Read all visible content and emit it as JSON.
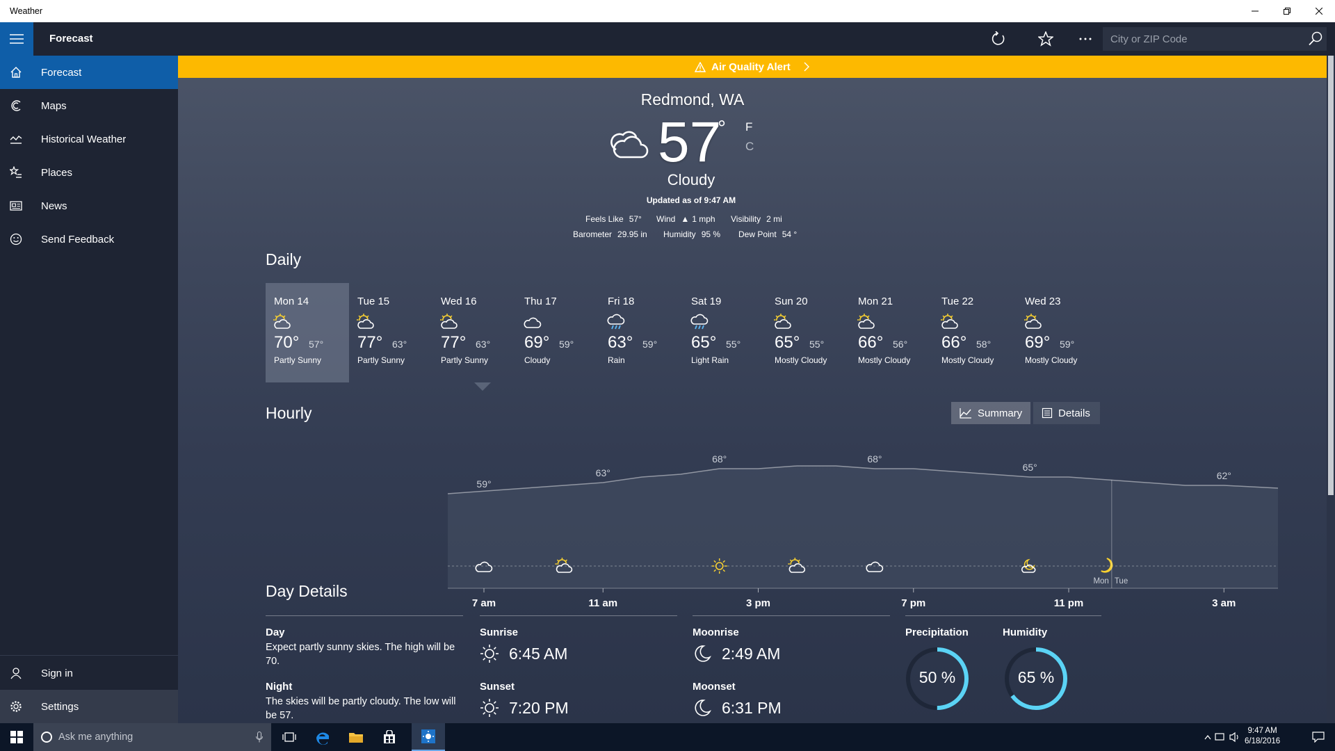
{
  "window": {
    "title": "Weather"
  },
  "appbar": {
    "title": "Forecast",
    "search_placeholder": "City or ZIP Code"
  },
  "sidebar": {
    "items": [
      {
        "label": "Forecast",
        "icon": "home-icon"
      },
      {
        "label": "Maps",
        "icon": "maps-icon"
      },
      {
        "label": "Historical Weather",
        "icon": "historical-icon"
      },
      {
        "label": "Places",
        "icon": "places-icon"
      },
      {
        "label": "News",
        "icon": "news-icon"
      },
      {
        "label": "Send Feedback",
        "icon": "feedback-icon"
      }
    ],
    "bottom": [
      {
        "label": "Sign in",
        "icon": "person-icon"
      },
      {
        "label": "Settings",
        "icon": "gear-icon"
      }
    ]
  },
  "alert": {
    "label": "Air Quality Alert",
    "color": "#fdb900"
  },
  "current": {
    "city": "Redmond, WA",
    "temp": "57",
    "deg": "°",
    "unit_f": "F",
    "unit_c": "C",
    "condition": "Cloudy",
    "updated": "Updated as of 9:47 AM",
    "stats": {
      "feels_like_label": "Feels Like",
      "feels_like": "57°",
      "wind_label": "Wind",
      "wind": "1 mph",
      "visibility_label": "Visibility",
      "visibility": "2 mi",
      "barometer_label": "Barometer",
      "barometer": "29.95 in",
      "humidity_label": "Humidity",
      "humidity": "95 %",
      "dewpoint_label": "Dew Point",
      "dewpoint": "54 °"
    }
  },
  "daily": {
    "title": "Daily",
    "days": [
      {
        "day": "Mon 14",
        "hi": "70°",
        "lo": "57°",
        "cond": "Partly Sunny",
        "icon": "partly-sunny-icon"
      },
      {
        "day": "Tue 15",
        "hi": "77°",
        "lo": "63°",
        "cond": "Partly Sunny",
        "icon": "partly-sunny-icon"
      },
      {
        "day": "Wed 16",
        "hi": "77°",
        "lo": "63°",
        "cond": "Partly Sunny",
        "icon": "partly-sunny-icon"
      },
      {
        "day": "Thu 17",
        "hi": "69°",
        "lo": "59°",
        "cond": "Cloudy",
        "icon": "cloudy-icon"
      },
      {
        "day": "Fri 18",
        "hi": "63°",
        "lo": "59°",
        "cond": "Rain",
        "icon": "rain-icon"
      },
      {
        "day": "Sat 19",
        "hi": "65°",
        "lo": "55°",
        "cond": "Light Rain",
        "icon": "rain-icon"
      },
      {
        "day": "Sun 20",
        "hi": "65°",
        "lo": "55°",
        "cond": "Mostly Cloudy",
        "icon": "partly-sunny-icon"
      },
      {
        "day": "Mon 21",
        "hi": "66°",
        "lo": "56°",
        "cond": "Mostly Cloudy",
        "icon": "partly-sunny-icon"
      },
      {
        "day": "Tue 22",
        "hi": "66°",
        "lo": "58°",
        "cond": "Mostly Cloudy",
        "icon": "partly-sunny-icon"
      },
      {
        "day": "Wed 23",
        "hi": "69°",
        "lo": "59°",
        "cond": "Mostly Cloudy",
        "icon": "partly-sunny-icon"
      }
    ]
  },
  "hourly": {
    "title": "Hourly",
    "summary_label": "Summary",
    "details_label": "Details",
    "day_divider_labels": [
      "Mon",
      "Tue"
    ]
  },
  "chart_data": {
    "type": "area",
    "title": "",
    "x": [
      "7 am",
      "8 am",
      "9 am",
      "10 am",
      "11 am",
      "12 pm",
      "1 pm",
      "2 pm",
      "3 pm",
      "4 pm",
      "5 pm",
      "6 pm",
      "7 pm",
      "8 pm",
      "9 pm",
      "10 pm",
      "11 pm",
      "12 am",
      "1 am",
      "2 am",
      "3 am",
      "4 am"
    ],
    "values": [
      59,
      60,
      61,
      62,
      63,
      65,
      66,
      68,
      68,
      69,
      69,
      68,
      68,
      67,
      66,
      65,
      65,
      64,
      63,
      62,
      62,
      61
    ],
    "value_labels": [
      {
        "x": "7 am",
        "label": "59°"
      },
      {
        "x": "11 am",
        "label": "63°"
      },
      {
        "x": "2 pm",
        "label": "68°"
      },
      {
        "x": "6 pm",
        "label": "68°"
      },
      {
        "x": "10 pm",
        "label": "65°"
      },
      {
        "x": "3 am",
        "label": "62°"
      }
    ],
    "x_ticks": [
      "7 am",
      "11 am",
      "3 pm",
      "7 pm",
      "11 pm",
      "3 am"
    ],
    "icons": [
      {
        "x": "7 am",
        "icon": "cloudy-icon"
      },
      {
        "x": "10 am",
        "icon": "partly-sunny-icon"
      },
      {
        "x": "2 pm",
        "icon": "sunny-icon"
      },
      {
        "x": "4 pm",
        "icon": "partly-sunny-icon"
      },
      {
        "x": "6 pm",
        "icon": "cloudy-icon"
      },
      {
        "x": "10 pm",
        "icon": "partly-cloudy-night-icon"
      },
      {
        "x": "12 am",
        "icon": "moon-icon"
      }
    ],
    "day_divider": "12 am",
    "ylim": [
      50,
      75
    ]
  },
  "day_details": {
    "title": "Day Details",
    "day_label": "Day",
    "day_text": "Expect partly sunny skies. The high will be 70.",
    "night_label": "Night",
    "night_text": "The skies will be partly cloudy. The low will be 57.",
    "sunrise_label": "Sunrise",
    "sunrise": "6:45 AM",
    "sunset_label": "Sunset",
    "sunset": "7:20 PM",
    "moonrise_label": "Moonrise",
    "moonrise": "2:49 AM",
    "moonset_label": "Moonset",
    "moonset": "6:31 PM",
    "precip_label": "Precipitation",
    "precip_text": "50 %",
    "precip_value": 0.5,
    "humidity_label": "Humidity",
    "humidity_text": "65 %",
    "humidity_value": 0.65,
    "ring_color": "#5bd3f5"
  },
  "taskbar": {
    "search_placeholder": "Ask me anything",
    "time": "9:47 AM",
    "date": "6/18/2016"
  }
}
